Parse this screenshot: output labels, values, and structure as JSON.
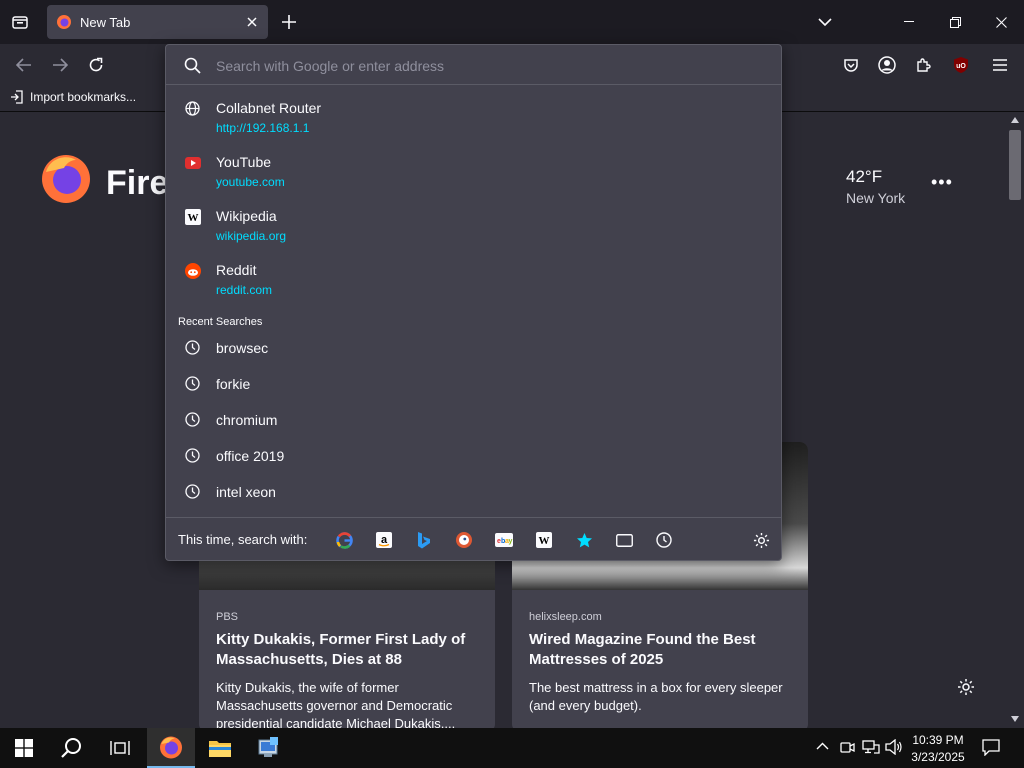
{
  "tab": {
    "title": "New Tab"
  },
  "bookmarks": {
    "import_label": "Import bookmarks..."
  },
  "newtab": {
    "logo_word": "Fire",
    "weather": {
      "temp": "42°F",
      "city": "New York",
      "more": "•••"
    },
    "cards": [
      {
        "source": "PBS",
        "headline": "Kitty Dukakis, Former First Lady of Massachusetts, Dies at 88",
        "excerpt": "Kitty Dukakis, the wife of former Massachusetts governor and Democratic presidential candidate Michael Dukakis,..."
      },
      {
        "source": "helixsleep.com",
        "headline": "Wired Magazine Found the Best Mattresses of 2025",
        "excerpt": "The best mattress in a box for every sleeper (and every budget)."
      }
    ]
  },
  "urlbar": {
    "placeholder": "Search with Google or enter address",
    "suggestions": [
      {
        "name": "Collabnet Router",
        "url": "http://192.168.1.1",
        "icon": "globe-icon"
      },
      {
        "name": "YouTube",
        "url": "youtube.com",
        "icon": "youtube-icon"
      },
      {
        "name": "Wikipedia",
        "url": "wikipedia.org",
        "icon": "wikipedia-icon"
      },
      {
        "name": "Reddit",
        "url": "reddit.com",
        "icon": "reddit-icon"
      }
    ],
    "recent_label": "Recent Searches",
    "recent": [
      "browsec",
      "forkie",
      "chromium",
      "office 2019",
      "intel xeon"
    ],
    "oneoff_label": "This time, search with:",
    "engines": [
      "google-icon",
      "amazon-icon",
      "bing-icon",
      "duckduckgo-icon",
      "ebay-icon",
      "wikipedia-icon",
      "bookmarks-star-icon",
      "tabs-icon",
      "history-icon"
    ]
  },
  "taskbar": {
    "time": "10:39 PM",
    "date": "3/23/2025"
  },
  "colors": {
    "accent_url": "#00ddff",
    "panel": "#42414d",
    "toolbar": "#2b2a33",
    "tabstrip": "#1c1b22"
  }
}
